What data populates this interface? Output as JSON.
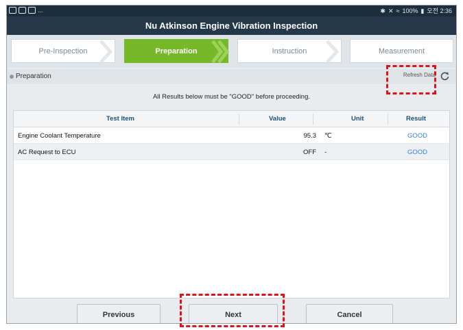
{
  "status_bar": {
    "left_dots": "...",
    "right_text": "100%",
    "clock": "오전 2:36"
  },
  "title": "Nu Atkinson Engine Vibration Inspection",
  "steps": [
    {
      "label": "Pre-Inspection",
      "active": false
    },
    {
      "label": "Preparation",
      "active": true
    },
    {
      "label": "Instruction",
      "active": false
    },
    {
      "label": "Measurement",
      "active": false
    }
  ],
  "section": {
    "title": "Preparation",
    "refresh_label": "Refresh Data"
  },
  "notice": "All Results below must be \"GOOD\" before proceeding.",
  "table": {
    "headers": {
      "item": "Test Item",
      "value": "Value",
      "unit": "Unit",
      "result": "Result"
    },
    "rows": [
      {
        "item": "Engine Coolant Temperature",
        "value": "95.3",
        "unit": "℃",
        "result": "GOOD"
      },
      {
        "item": "AC Request to ECU",
        "value": "OFF",
        "unit": "-",
        "result": "GOOD"
      }
    ]
  },
  "buttons": {
    "previous": "Previous",
    "next": "Next",
    "cancel": "Cancel"
  },
  "colors": {
    "accent_green": "#76b82a",
    "title_bg": "#243849",
    "result_blue": "#2e86d6",
    "highlight_red": "#e0131b"
  }
}
